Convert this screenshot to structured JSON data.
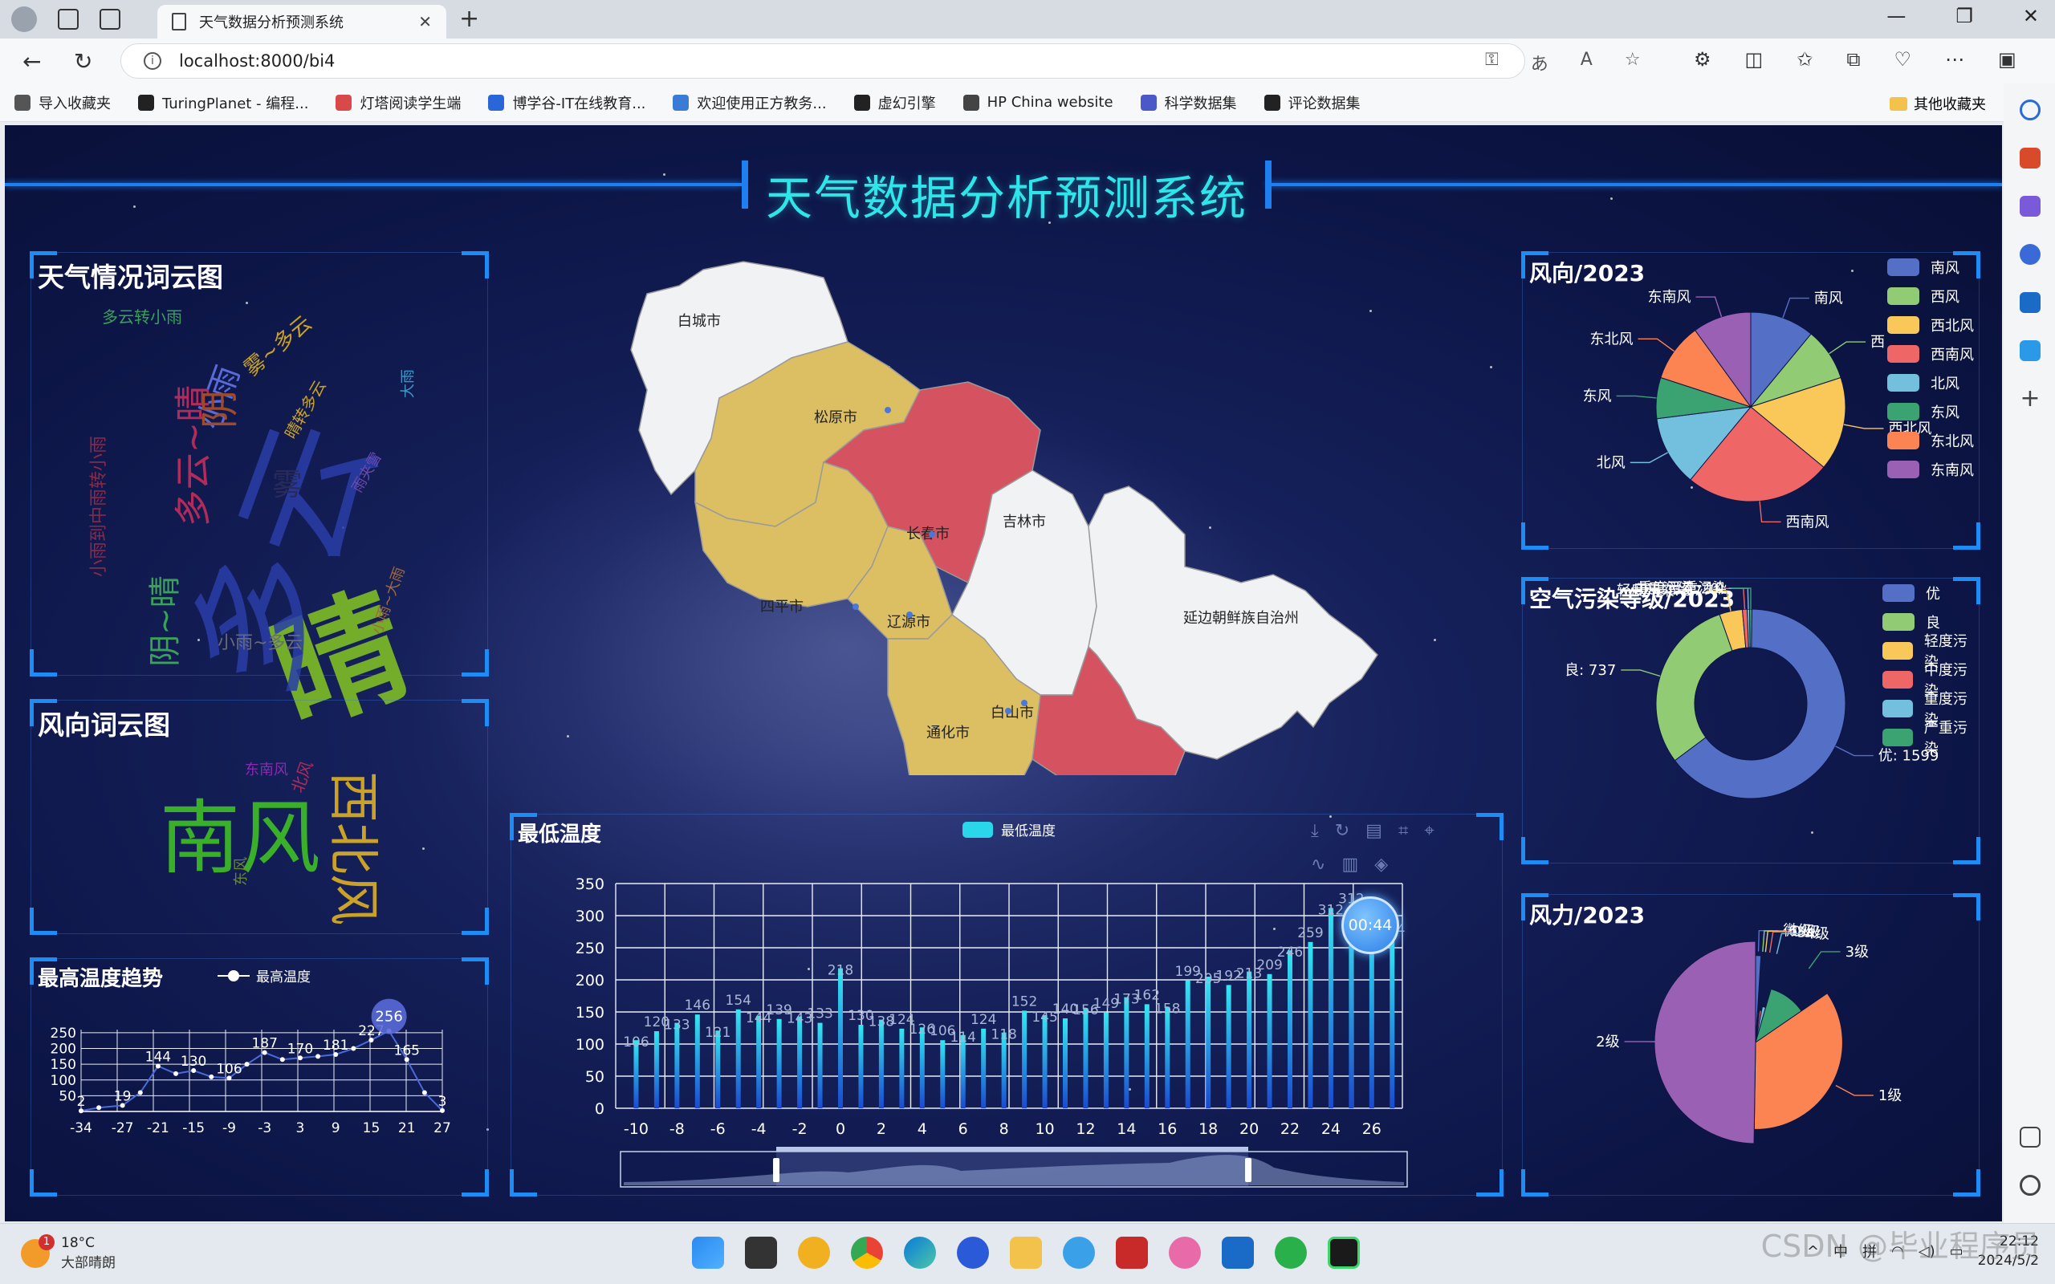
{
  "browser": {
    "tab_title": "天气数据分析预测系统",
    "url": "localhost:8000/bi4",
    "bookmarks": [
      {
        "label": "导入收藏夹",
        "color": "#555555"
      },
      {
        "label": "TuringPlanet - 编程...",
        "color": "#222222"
      },
      {
        "label": "灯塔阅读学生端",
        "color": "#d84a4a"
      },
      {
        "label": "博学谷-IT在线教育...",
        "color": "#2a66d8"
      },
      {
        "label": "欢迎使用正方教务...",
        "color": "#3a7bd5"
      },
      {
        "label": "虚幻引擎",
        "color": "#222222"
      },
      {
        "label": "HP China website",
        "color": "#444444"
      },
      {
        "label": "科学数据集",
        "color": "#4a58c8"
      },
      {
        "label": "评论数据集",
        "color": "#222222"
      }
    ],
    "other_bookmarks": "其他收藏夹"
  },
  "dashboard": {
    "title": "天气数据分析预测系统",
    "panels": {
      "weather_cloud": "天气情况词云图",
      "wind_cloud": "风向词云图",
      "max_temp": "最高温度趋势",
      "min_temp": "最低温度",
      "wind_dir": "风向/2023",
      "air": "空气污染等级/2023",
      "wind_power": "风力/2023"
    },
    "weather_words": [
      {
        "text": "多云转小雨",
        "color": "#3aa05a"
      },
      {
        "text": "小雨",
        "color": "#5a6ad6"
      },
      {
        "text": "雾~多云",
        "color": "#c9a227"
      },
      {
        "text": "多云~晴",
        "color": "#b02c5a"
      },
      {
        "text": "晴",
        "color": "#73ad2a"
      },
      {
        "text": "多云",
        "color": "#2a3ea8"
      },
      {
        "text": "雾",
        "color": "#2a2a5a"
      },
      {
        "text": "阴~晴",
        "color": "#3aa05a"
      },
      {
        "text": "小雨~多云",
        "color": "#6a6a7a"
      },
      {
        "text": "小雨到中雨转小雨",
        "color": "#8a2a4a"
      },
      {
        "text": "阴",
        "color": "#a04a2a"
      },
      {
        "text": "晴转多云",
        "color": "#c9a227"
      },
      {
        "text": "大雨",
        "color": "#3a9ac8"
      },
      {
        "text": "雨夹雪",
        "color": "#6a4ab0"
      },
      {
        "text": "小雨~大雨",
        "color": "#a06a3a"
      }
    ],
    "wind_words": [
      {
        "text": "南风",
        "color": "#3ab02a"
      },
      {
        "text": "西北风",
        "color": "#c9a227"
      },
      {
        "text": "东风",
        "color": "#6a8a2a"
      },
      {
        "text": "北风",
        "color": "#b02c5a"
      },
      {
        "text": "东南风",
        "color": "#8a2ab0"
      }
    ],
    "map_cities": [
      "白城市",
      "松原市",
      "长春市",
      "吉林市",
      "四平市",
      "辽源市",
      "延边朝鲜族自治州",
      "白山市",
      "通化市"
    ],
    "min_temp_legend": "最低温度",
    "max_temp_legend": "最高温度",
    "timer": "00:44"
  },
  "chart_data": [
    {
      "type": "bar",
      "title": "最低温度",
      "legend": "最低温度",
      "x_ticks": [
        -10,
        -8,
        -6,
        -4,
        -2,
        0,
        2,
        4,
        6,
        8,
        10,
        12,
        14,
        16,
        18,
        20,
        22,
        24,
        26
      ],
      "ylim": [
        0,
        350
      ],
      "y_ticks": [
        0,
        50,
        100,
        150,
        200,
        250,
        300,
        350
      ],
      "x": [
        -10,
        -9,
        -8,
        -7,
        -6,
        -5,
        -4,
        -3,
        -2,
        -1,
        0,
        1,
        2,
        3,
        4,
        5,
        6,
        7,
        8,
        9,
        10,
        11,
        12,
        13,
        14,
        15,
        16,
        17,
        18,
        19,
        20,
        21,
        22,
        23,
        24,
        25,
        26,
        27
      ],
      "values": [
        106,
        120,
        133,
        146,
        121,
        154,
        144,
        139,
        143,
        133,
        218,
        130,
        138,
        124,
        126,
        106,
        114,
        124,
        118,
        152,
        145,
        140,
        156,
        149,
        173,
        162,
        158,
        199,
        205,
        192,
        213,
        209,
        246,
        259,
        312,
        312,
        297,
        264
      ],
      "labels": [
        "106",
        "120",
        "133",
        "146",
        "121",
        "154",
        "144",
        "139",
        "143",
        "133",
        "218",
        "130",
        "138",
        "124",
        "126",
        "106",
        "114",
        "124",
        "118",
        "152",
        "145",
        "140",
        "156",
        "149",
        "173",
        "162",
        "158",
        "199",
        "205",
        "192",
        "213",
        "209",
        "246",
        "259",
        "312",
        "312",
        "297",
        "264"
      ]
    },
    {
      "type": "line",
      "title": "最高温度趋势",
      "legend": "最高温度",
      "x_ticks": [
        -34,
        -27,
        -21,
        -15,
        -9,
        -3,
        3,
        9,
        15,
        21,
        27
      ],
      "y_ticks": [
        50,
        100,
        150,
        200,
        250
      ],
      "ylim": [
        0,
        260
      ],
      "x": [
        -34,
        -31,
        -27,
        -24,
        -21,
        -18,
        -15,
        -12,
        -9,
        -6,
        -3,
        0,
        3,
        6,
        9,
        12,
        15,
        18,
        21,
        24,
        27
      ],
      "values": [
        2,
        12,
        19,
        60,
        144,
        120,
        130,
        110,
        106,
        150,
        187,
        165,
        170,
        175,
        181,
        200,
        227,
        256,
        165,
        60,
        3
      ],
      "data_labels": [
        {
          "x": -34,
          "value": "2"
        },
        {
          "x": -27,
          "value": "19"
        },
        {
          "x": -21,
          "value": "144"
        },
        {
          "x": -15,
          "value": "130"
        },
        {
          "x": -9,
          "value": "106"
        },
        {
          "x": -3,
          "value": "187"
        },
        {
          "x": 3,
          "value": "170"
        },
        {
          "x": 9,
          "value": "181"
        },
        {
          "x": 15,
          "value": "227"
        },
        {
          "x": 18,
          "value": "256"
        },
        {
          "x": 21,
          "value": "165"
        },
        {
          "x": 27,
          "value": "3"
        }
      ]
    },
    {
      "type": "pie",
      "title": "风向/2023",
      "categories": [
        "南风",
        "西风",
        "西北风",
        "西南风",
        "北风",
        "东风",
        "东北风",
        "东南风"
      ],
      "values": [
        0.11,
        0.09,
        0.16,
        0.25,
        0.12,
        0.07,
        0.1,
        0.1
      ],
      "colors": [
        "#5470c6",
        "#91cc75",
        "#fac858",
        "#ee6666",
        "#73c0de",
        "#3ba272",
        "#fc8452",
        "#9a60b4"
      ],
      "slice_labels": [
        "南风",
        "西",
        "西北风",
        "西南风",
        "北风",
        "东风",
        "东北风",
        "东南风"
      ],
      "legend_position": "right"
    },
    {
      "type": "pie",
      "title": "空气污染等级/2023",
      "donut": true,
      "categories": [
        "优",
        "良",
        "轻度污染",
        "中度污染",
        "重度污染",
        "严重污染"
      ],
      "values": [
        1599,
        737,
        97,
        20,
        10,
        5
      ],
      "colors": [
        "#5470c6",
        "#91cc75",
        "#fac858",
        "#ee6666",
        "#73c0de",
        "#3ba272"
      ],
      "slice_labels": [
        "优: 1599",
        "良: 737",
        "轻度污染: 97",
        "中度污染: 20",
        "重度污染: 10",
        "严重污染"
      ],
      "legend_position": "right"
    },
    {
      "type": "pie",
      "title": "风力/2023",
      "rose": true,
      "categories": [
        "微",
        "6级",
        "0级",
        "5级",
        "4级",
        "3级",
        "1级",
        "2级"
      ],
      "values": [
        0.01,
        0.005,
        0.005,
        0.01,
        0.015,
        0.11,
        0.35,
        0.5
      ],
      "radii": [
        0.86,
        0.3,
        0.3,
        0.32,
        0.36,
        0.55,
        0.86,
        1.0
      ],
      "colors": [
        "#5470c6",
        "#91cc75",
        "#fac858",
        "#ee6666",
        "#73c0de",
        "#3ba272",
        "#fc8452",
        "#9a60b4"
      ]
    }
  ],
  "taskbar": {
    "temperature": "18°C",
    "weather": "大部晴朗",
    "notification_count": "1",
    "time": "22:12",
    "date": "2024/5/2",
    "ime": "中",
    "ime2": "拼"
  },
  "watermark": "CSDN @毕业程序员"
}
